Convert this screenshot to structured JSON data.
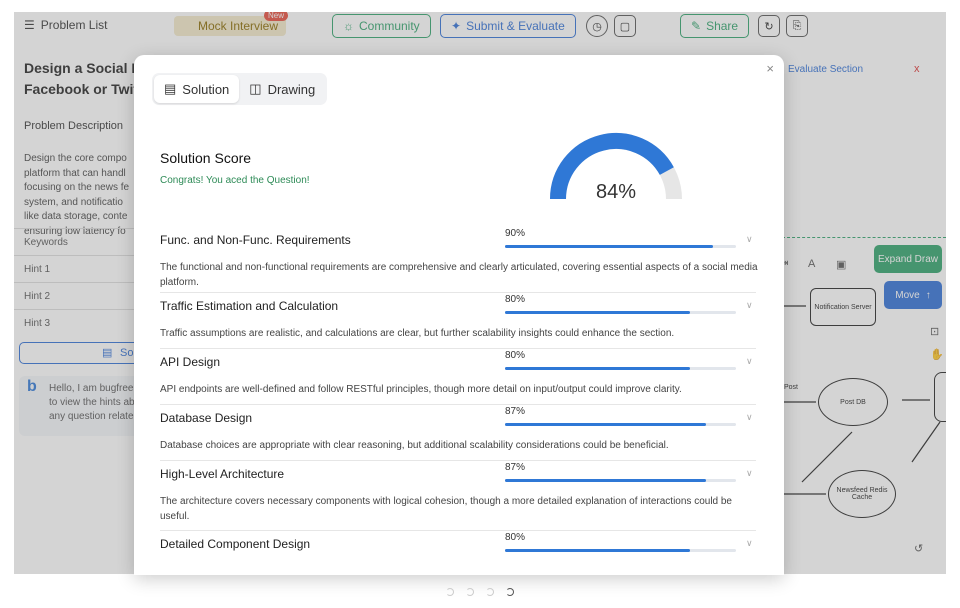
{
  "topbar": {
    "problem_list": "Problem List",
    "mock_interview": "Mock Interview",
    "new_badge": "New",
    "community": "Community",
    "submit": "Submit & Evaluate",
    "share": "Share"
  },
  "left": {
    "title_line1": "Design a Social M",
    "title_line2": "Facebook or Twit",
    "description_label": "Problem Description",
    "description_lines": [
      "Design the core compo",
      "platform that can handl",
      "focusing on the news fe",
      "system, and notificatio",
      "like data storage, conte",
      "ensuring low latency fo"
    ],
    "keywords": "Keywords",
    "hints": [
      "Hint 1",
      "Hint 2",
      "Hint 3"
    ],
    "solution_button": "So",
    "chat_lines": [
      "Hello, I am bugfree",
      "to view the hints ab",
      "any question relate"
    ]
  },
  "right": {
    "evaluate_section": "Evaluate Section",
    "close": "x",
    "expand_draw": "Expand Draw",
    "move": "Move",
    "nodes": {
      "notification": "Notification Server",
      "post_db": "Post DB",
      "newsfeed": "Newsfeed Redis Cache",
      "post_label": "Post"
    }
  },
  "modal": {
    "close": "×",
    "tabs": [
      "Solution",
      "Drawing"
    ],
    "score_title": "Solution Score",
    "congrats": "Congrats! You aced the Question!",
    "score": "84%",
    "score_value": 84,
    "items": [
      {
        "name": "Func. and Non-Func. Requirements",
        "pct": "90%",
        "value": 90,
        "desc": "The functional and non-functional requirements are comprehensive and clearly articulated, covering essential aspects of a social media platform."
      },
      {
        "name": "Traffic Estimation and Calculation",
        "pct": "80%",
        "value": 80,
        "desc": "Traffic assumptions are realistic, and calculations are clear, but further scalability insights could enhance the section."
      },
      {
        "name": "API Design",
        "pct": "80%",
        "value": 80,
        "desc": "API endpoints are well-defined and follow RESTful principles, though more detail on input/output could improve clarity."
      },
      {
        "name": "Database Design",
        "pct": "87%",
        "value": 87,
        "desc": "Database choices are appropriate with clear reasoning, but additional scalability considerations could be beneficial."
      },
      {
        "name": "High-Level Architecture",
        "pct": "87%",
        "value": 87,
        "desc": "The architecture covers necessary components with logical cohesion, though a more detailed explanation of interactions could be useful."
      },
      {
        "name": "Detailed Component Design",
        "pct": "80%",
        "value": 80,
        "desc": ""
      }
    ]
  },
  "colors": {
    "accent_blue": "#2f78d6",
    "accent_green": "#2fa36b",
    "gauge_track": "#e6e6e6"
  }
}
